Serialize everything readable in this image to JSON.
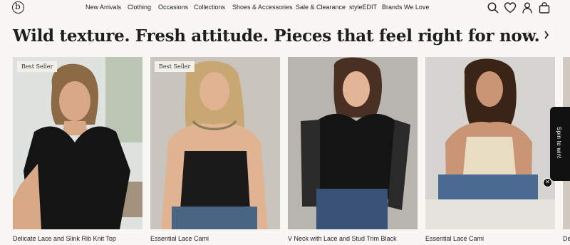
{
  "brand": {
    "logo_letter": "b"
  },
  "nav": {
    "items": [
      "New Arrivals",
      "Clothing",
      "Occasions",
      "Collections",
      "Shoes & Accessories",
      "Sale & Clearance",
      "styleEDIT",
      "Brands We Love"
    ]
  },
  "header_icons": [
    "search-icon",
    "heart-icon",
    "account-icon",
    "bag-icon"
  ],
  "headline": "Wild texture. Fresh attitude. Pieces that feel right for now.",
  "carousel": {
    "prev_icon": "chevron-left-icon",
    "next_icon": "chevron-right-icon"
  },
  "products": [
    {
      "badge": "Best Seller",
      "name": "Delicate Lace and Slink Rib Knit Top"
    },
    {
      "badge": "Best Seller",
      "name": "Essential Lace Cami"
    },
    {
      "badge": "",
      "name": "V Neck with Lace and Stud Trim Black"
    },
    {
      "badge": "",
      "name": "Essential Lace Cami"
    },
    {
      "badge": "",
      "name": "De"
    }
  ],
  "promo": {
    "label": "Spin to win!",
    "close_glyph": "✕"
  },
  "colors": {
    "background": "#f8f7f3",
    "text": "#1e1e1e",
    "promo_bg": "#111111"
  }
}
